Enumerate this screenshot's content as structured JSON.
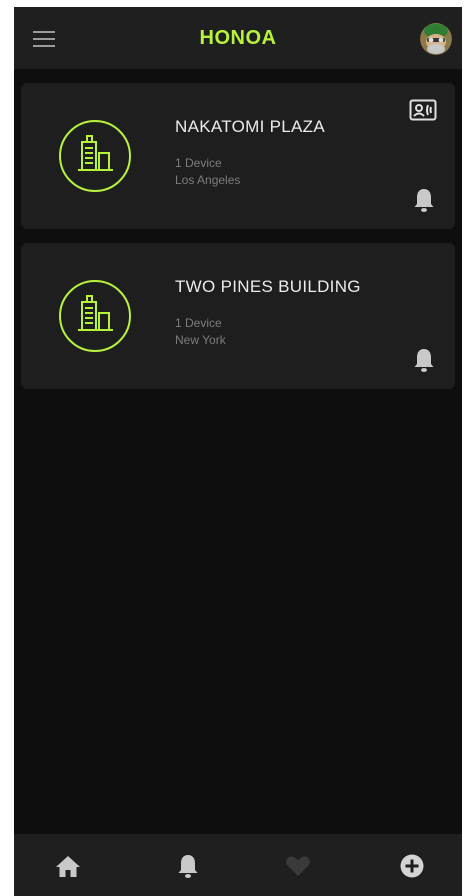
{
  "app": {
    "title": "HONOA"
  },
  "colors": {
    "accent": "#b8f23a",
    "background": "#0e0e0e",
    "surface": "#1e1e1e",
    "bar": "#1f1f1f",
    "text_primary": "#ececec",
    "text_secondary": "#7d7d7d",
    "icon": "#c9c9c9"
  },
  "header": {
    "menu_icon": "hamburger-menu-icon",
    "avatar_icon": "user-avatar"
  },
  "buildings": [
    {
      "name": "NAKATOMI PLAZA",
      "devices": "1 Device",
      "city": "Los Angeles",
      "icon": "building-icon",
      "has_contact_badge": true
    },
    {
      "name": "TWO PINES BUILDING",
      "devices": "1 Device",
      "city": "New York",
      "icon": "building-icon",
      "has_contact_badge": false
    }
  ],
  "bottom_nav": [
    {
      "icon": "home-icon"
    },
    {
      "icon": "bell-icon"
    },
    {
      "icon": "heart-icon"
    },
    {
      "icon": "add-circle-icon"
    }
  ]
}
